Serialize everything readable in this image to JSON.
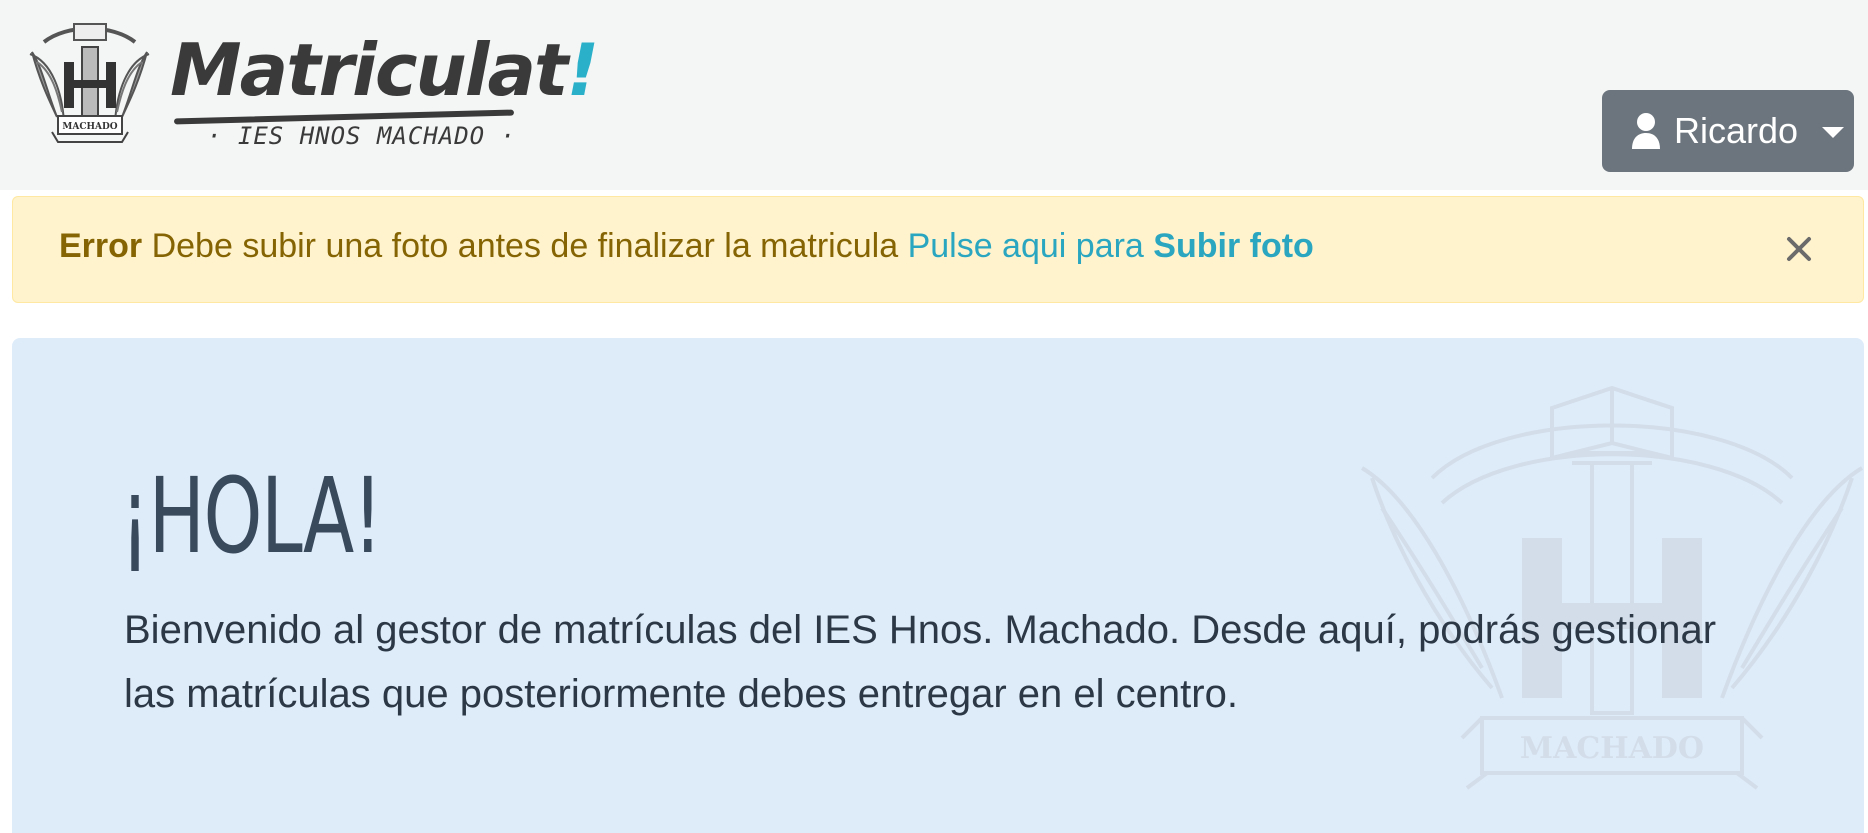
{
  "header": {
    "brand": {
      "name": "Matriculat",
      "accent": "!",
      "subtitle": "· IES HNOS  MACHADO ·",
      "crest_text": "MACHADO"
    },
    "user_menu": {
      "label": "Ricardo",
      "icon": "user-icon",
      "dropdown_icon": "caret-down-icon"
    }
  },
  "alert": {
    "title": "Error",
    "message": " Debe subir una foto antes de finalizar la matricula ",
    "link_prefix": "Pulse aqui para ",
    "link_action": "Subir foto",
    "close_icon": "close-icon"
  },
  "jumbotron": {
    "heading": "¡HOLA!",
    "text": "Bienvenido al gestor de matrículas del IES Hnos. Machado. Desde aquí, podrás gestionar las matrículas que posteriormente debes entregar en el centro.",
    "watermark_text": "MACHADO"
  },
  "colors": {
    "header_bg": "#f4f5f5",
    "user_button_bg": "#6c757d",
    "alert_bg": "#fff3cd",
    "alert_text": "#856404",
    "link": "#2aa6c0",
    "jumbotron_bg": "#deebf9",
    "brand_accent": "#2ab0c9"
  }
}
